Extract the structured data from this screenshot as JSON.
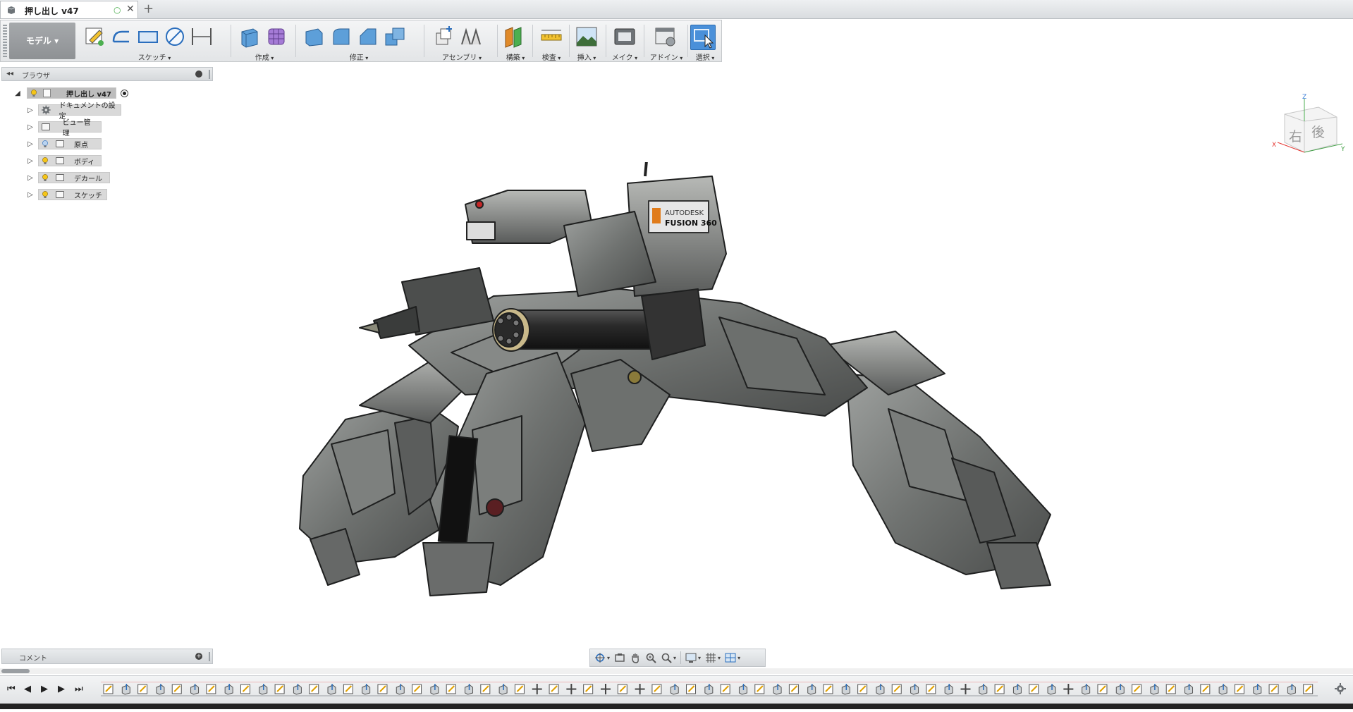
{
  "tab": {
    "title": "押し出し v47",
    "status_dot": "○",
    "close": "✕",
    "new_tab": "+"
  },
  "toolbar": {
    "workspace": "モデル ▾",
    "groups": [
      {
        "label": "スケッチ"
      },
      {
        "label": "作成"
      },
      {
        "label": "修正"
      },
      {
        "label": "アセンブリ"
      },
      {
        "label": "構築"
      },
      {
        "label": "検査"
      },
      {
        "label": "挿入"
      },
      {
        "label": "メイク"
      },
      {
        "label": "アドイン"
      },
      {
        "label": "選択"
      }
    ]
  },
  "browser": {
    "title": "ブラウザ",
    "collapse": "◂◂",
    "root": {
      "label": "押し出し v47"
    },
    "items": [
      {
        "label": "ドキュメントの設定",
        "icon": "gear-icon"
      },
      {
        "label": "ビュー管理",
        "icon": "folder-icon"
      },
      {
        "label": "原点",
        "icon": "folder-icon"
      },
      {
        "label": "ボディ",
        "icon": "folder-icon"
      },
      {
        "label": "デカール",
        "icon": "folder-icon"
      },
      {
        "label": "スケッチ",
        "icon": "folder-icon"
      }
    ]
  },
  "comment": {
    "title": "コメント",
    "plus": "+"
  },
  "viewcube": {
    "face_right": "右",
    "face_back": "後",
    "axis_z": "Z",
    "axis_x": "X",
    "axis_y": "Y"
  },
  "decal": {
    "brand": "AUTODESK",
    "product": "FUSION 360"
  },
  "timeline": {
    "first": "⏮",
    "prev": "◀",
    "play": "▶",
    "next": "▶",
    "last": "⏭"
  },
  "colors": {
    "accent": "#4a90d9",
    "select_active": "#4a90d9",
    "bulb": "#f5c518"
  }
}
